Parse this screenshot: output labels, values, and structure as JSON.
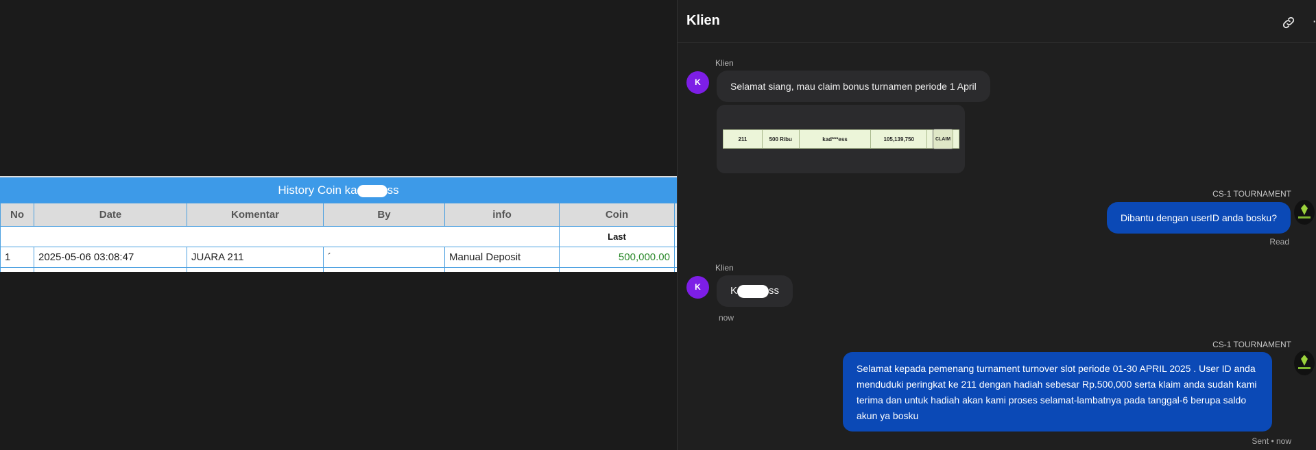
{
  "history": {
    "title_prefix": "History Coin ka",
    "title_suffix": "ss",
    "columns": [
      "No",
      "Date",
      "Komentar",
      "By",
      "info",
      "Coin"
    ],
    "subheader": "Last",
    "rows": [
      {
        "no": "1",
        "date": "2025-05-06 03:08:47",
        "komentar": "JUARA 211",
        "by": "´",
        "info": "Manual Deposit",
        "coin": "500,000.00"
      }
    ]
  },
  "chat": {
    "title": "Klien",
    "link_icon": "link-icon",
    "more_icon": "more-icon",
    "messages": {
      "m1_sender": "Klien",
      "m1_avatar": "K",
      "m1_text": "Selamat siang, mau claim bonus turnamen periode 1 April",
      "image": {
        "rank": "211",
        "prize": "500 Ribu",
        "user": "kad***ess",
        "turnover": "105,139,750",
        "button": "CLAIM"
      },
      "m2_sender": "CS-1 TOURNAMENT",
      "m2_text": "Dibantu dengan userID anda bosku?",
      "m2_status": "Read",
      "m3_sender": "Klien",
      "m3_avatar": "K",
      "m3_text_prefix": "K",
      "m3_text_suffix": "ss",
      "m3_time": "now",
      "m4_sender": "CS-1 TOURNAMENT",
      "m4_text": "Selamat kepada pemenang turnament turnover slot periode 01-30 APRIL 2025 . User ID anda menduduki peringkat ke 211 dengan hadiah sebesar Rp.500,000 serta klaim anda sudah kami terima dan untuk hadiah akan kami proses selamat-lambatnya pada tanggal-6 berupa saldo akun ya bosku",
      "m4_status": "Sent • now"
    }
  },
  "colors": {
    "accent_blue": "#0b49b6",
    "table_header": "#3d9ae8",
    "avatar_purple": "#7d1ee6",
    "coin_green": "#2d8a2d"
  }
}
